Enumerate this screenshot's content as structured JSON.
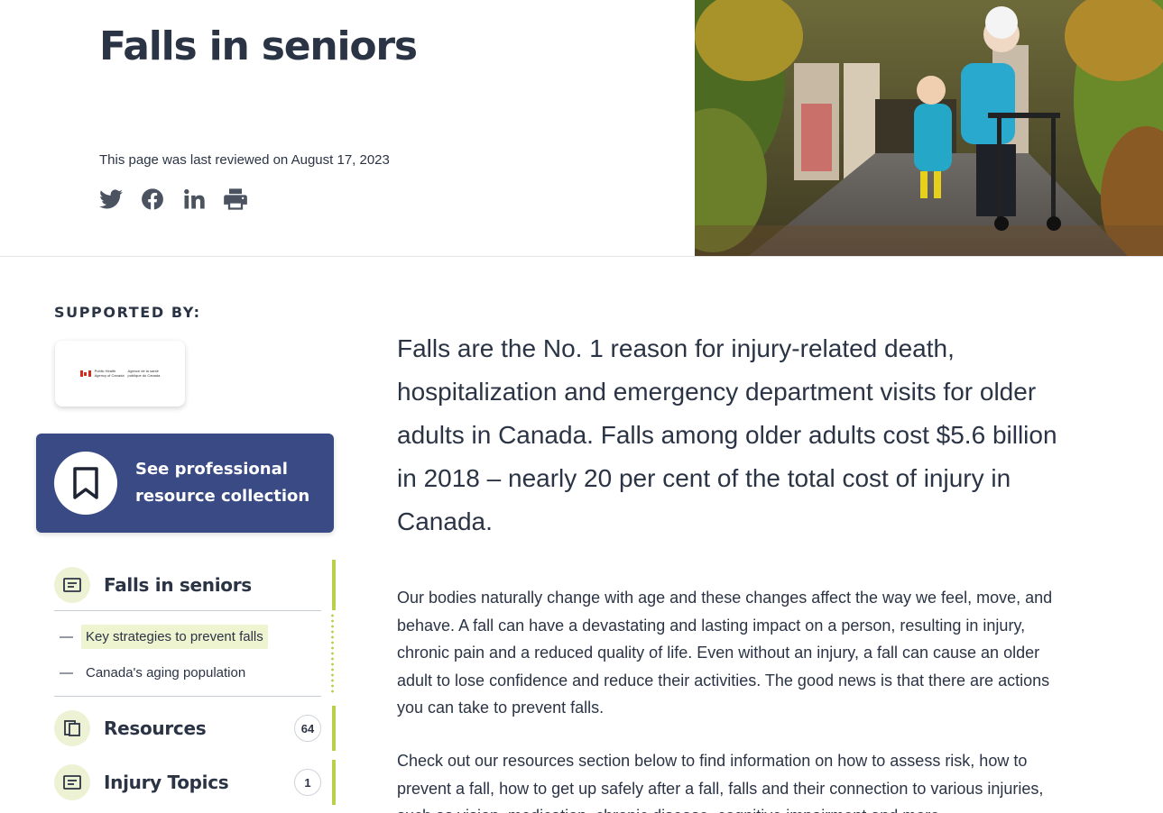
{
  "header": {
    "title": "Falls in seniors",
    "reviewed": "This page was last reviewed on August 17, 2023",
    "share_icons": [
      "twitter-icon",
      "facebook-icon",
      "linkedin-icon",
      "print-icon"
    ]
  },
  "sidebar": {
    "supported_by": "SUPPORTED BY:",
    "sponsor": {
      "line1_en": "Public Health",
      "line2_en": "Agency of Canada",
      "line1_fr": "Agence de la santé",
      "line2_fr": "publique du Canada"
    },
    "pro_card": {
      "label": "See professional resource collection"
    },
    "nav": {
      "main": {
        "label": "Falls in seniors",
        "icon": "article-icon"
      },
      "sub_items": [
        {
          "label": "Key strategies to prevent falls",
          "active": true
        },
        {
          "label": "Canada's aging population",
          "active": false
        }
      ],
      "resources": {
        "label": "Resources",
        "count": "64",
        "icon": "documents-icon"
      },
      "injury_topics": {
        "label": "Injury Topics",
        "count": "1",
        "icon": "article-icon"
      }
    }
  },
  "main": {
    "lead": "Falls are the No. 1 reason for injury-related death, hospitalization and emergency department visits for older adults in Canada. Falls among older adults cost $5.6 billion in 2018 – nearly 20 per cent of the total cost of injury in Canada.",
    "paragraph1": "Our bodies naturally change with age and these changes affect the way we feel, move, and behave. A fall can have a devastating and lasting impact on a person, resulting in injury, chronic pain and a reduced quality of life. Even without an injury, a fall can cause an older adult to lose confidence and reduce their activities. The good news is that there are actions you can take to prevent falls.",
    "paragraph2": "Check out our resources section below to find information on how to assess risk, how to prevent a fall, how to get up safely after a fall, falls and their connection to various injuries, such as vision, medication, chronic disease, cognitive impairment and more."
  },
  "colors": {
    "text": "#2b3445",
    "card_blue": "#3a4a84",
    "accent_green": "#b8d04a",
    "highlight": "#eef3d0"
  }
}
